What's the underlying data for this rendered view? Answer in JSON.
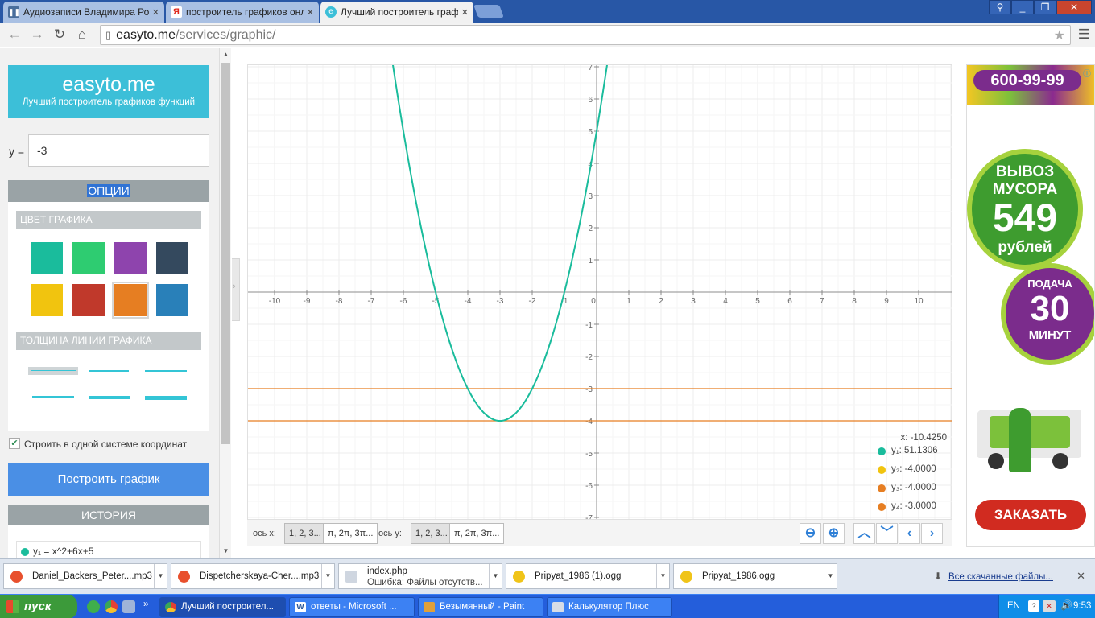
{
  "browser": {
    "tabs": [
      {
        "title": "Аудиозаписи Владимира Ро",
        "icon": "vk-pause-icon"
      },
      {
        "title": "построитель графиков онл",
        "icon": "yandex-icon"
      },
      {
        "title": "Лучший построитель граф",
        "icon": "easyto-icon"
      }
    ],
    "address_domain": "easyto.me",
    "address_path": "/services/graphic/"
  },
  "app": {
    "logo_title": "easyto.me",
    "logo_subtitle": "Лучший построитель графиков функций",
    "y_label": "y =",
    "y_input_value": "-3",
    "options_title": "ОПЦИИ",
    "color_section": "ЦВЕТ ГРАФИКА",
    "colors": [
      "#1abc9c",
      "#2ecc71",
      "#8e44ad",
      "#34495e",
      "#f1c40f",
      "#c0392b",
      "#e67e22",
      "#2980b9"
    ],
    "selected_color_index": 6,
    "thickness_section": "ТОЛЩИНА ЛИНИИ ГРАФИКА",
    "same_axes_label": "Строить в одной системе координат",
    "same_axes_checked": true,
    "build_button": "Построить график",
    "history_title": "ИСТОРИЯ",
    "history_item": "y₁ = x^2+6x+5"
  },
  "chart_data": {
    "type": "line",
    "xlim": [
      -10,
      10
    ],
    "ylim": [
      -7,
      7
    ],
    "x_ticks": [
      -10,
      -9,
      -8,
      -7,
      -6,
      -5,
      -4,
      -3,
      -2,
      -1,
      0,
      1,
      2,
      3,
      4,
      5,
      6,
      7,
      8,
      9,
      10
    ],
    "y_ticks": [
      7,
      6,
      5,
      4,
      3,
      2,
      1,
      -1,
      -2,
      -3,
      -4,
      -5,
      -6,
      -7
    ],
    "grid": true,
    "series": [
      {
        "name": "y₁",
        "formula": "x^2+6x+5",
        "color": "#1abc9c"
      },
      {
        "name": "y₂",
        "value": -4,
        "color": "#f1c40f"
      },
      {
        "name": "y₃",
        "value": -4,
        "color": "#e67e22"
      },
      {
        "name": "y₄",
        "value": -3,
        "color": "#e67e22"
      }
    ],
    "visible_horizontal_lines": [
      -3,
      -4
    ],
    "tooltip": {
      "x": "x: -10.4250",
      "rows": [
        {
          "label": "y₁:",
          "value": "51.1306",
          "color": "#1abc9c"
        },
        {
          "label": "y₂:",
          "value": "-4.0000",
          "color": "#f1c40f"
        },
        {
          "label": "y₃:",
          "value": "-4.0000",
          "color": "#e67e22"
        },
        {
          "label": "y₄:",
          "value": "-3.0000",
          "color": "#e67e22"
        }
      ]
    }
  },
  "graph_toolbar": {
    "x_axis_label": "ось x:",
    "y_axis_label": "ось y:",
    "numeric_label": "1, 2, 3...",
    "pi_label": "π, 2π, 3π..."
  },
  "ad": {
    "phone": "600-99-99",
    "line1": "ВЫВОЗ",
    "line2": "МУСОРА",
    "price": "549",
    "currency": "рублей",
    "supply": "ПОДАЧА",
    "minutes": "30",
    "minutes_word": "МИНУТ",
    "order": "ЗАКАЗАТЬ"
  },
  "downloads": {
    "items": [
      {
        "name": "Daniel_Backers_Peter....mp3",
        "sub": ""
      },
      {
        "name": "Dispetcherskaya-Cher....mp3",
        "sub": ""
      },
      {
        "name": "index.php",
        "sub": "Ошибка: Файлы отсутств..."
      },
      {
        "name": "Pripyat_1986 (1).ogg",
        "sub": ""
      },
      {
        "name": "Pripyat_1986.ogg",
        "sub": ""
      }
    ],
    "show_all": "Все скачанные файлы..."
  },
  "taskbar": {
    "start": "пуск",
    "tasks": [
      "Лучший построител...",
      "ответы - Microsoft ...",
      "Безымянный - Paint",
      "Калькулятор Плюс"
    ],
    "lang": "EN",
    "time": "9:53"
  }
}
